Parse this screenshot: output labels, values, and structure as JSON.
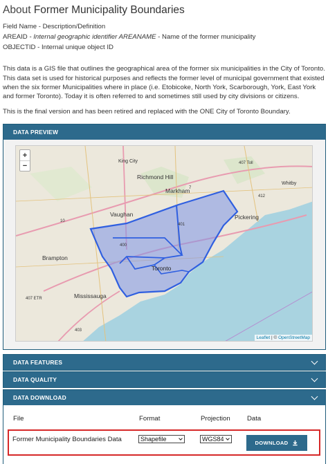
{
  "page": {
    "title_prefix": "About",
    "title_name": "Former Municipality Boundaries",
    "fields_heading": "Field Name - Description/Definition",
    "field1_name": "AREAID",
    "field1_desc": " - Internal geographic identifier AREANAME",
    "field1_rest": " - Name of the former municipality",
    "field2": "OBJECTID - Internal unique object ID",
    "para1": "This data is a GIS file that outlines the geographical area of the former six municipalities in the City of Toronto.",
    "para2": "This data set is used for historical purposes and reflects the former level of municipal government that existed when the six former Municipalities where in place (i.e. Etobicoke, North York, Scarborough, York, East York and former Toronto). Today it is often referred to and sometimes still used by city divisions or citizens.",
    "para3": "This is the final version and has been retired and replaced with the ONE City of Toronto Boundary."
  },
  "sections": {
    "preview": "DATA PREVIEW",
    "features": "DATA FEATURES",
    "quality": "DATA QUALITY",
    "download": "DATA DOWNLOAD"
  },
  "map": {
    "zoom_in": "+",
    "zoom_out": "−",
    "attribution_leaflet": "Leaflet",
    "attribution_sep": " | © ",
    "attribution_osm": "OpenStreetMap",
    "labels": {
      "king_city": "King City",
      "richmond_hill": "Richmond Hill",
      "markham": "Markham",
      "vaughan": "Vaughan",
      "pickering": "Pickering",
      "whitby": "Whitby",
      "brampton": "Brampton",
      "toronto": "Toronto",
      "mississauga": "Mississauga",
      "hwy407_toll": "407 Toll",
      "hwy407_etr": "407 ETR",
      "hwy400": "400",
      "hwy401": "401",
      "hwy403": "403",
      "hwy10": "10",
      "hwy412": "412",
      "hwy7": "7"
    },
    "colors": {
      "water": "#a9d3e0",
      "land": "#ece8dc",
      "boundary": "#2f5fe0",
      "boundary_fill": "#7d93e8"
    }
  },
  "download": {
    "col_file": "File",
    "col_format": "Format",
    "col_projection": "Projection",
    "col_data": "Data",
    "file_name": "Former Municipality Boundaries Data",
    "format_value": "Shapefile",
    "projection_value": "WGS84",
    "button_label": "DOWNLOAD",
    "button_icon": "download-icon"
  }
}
